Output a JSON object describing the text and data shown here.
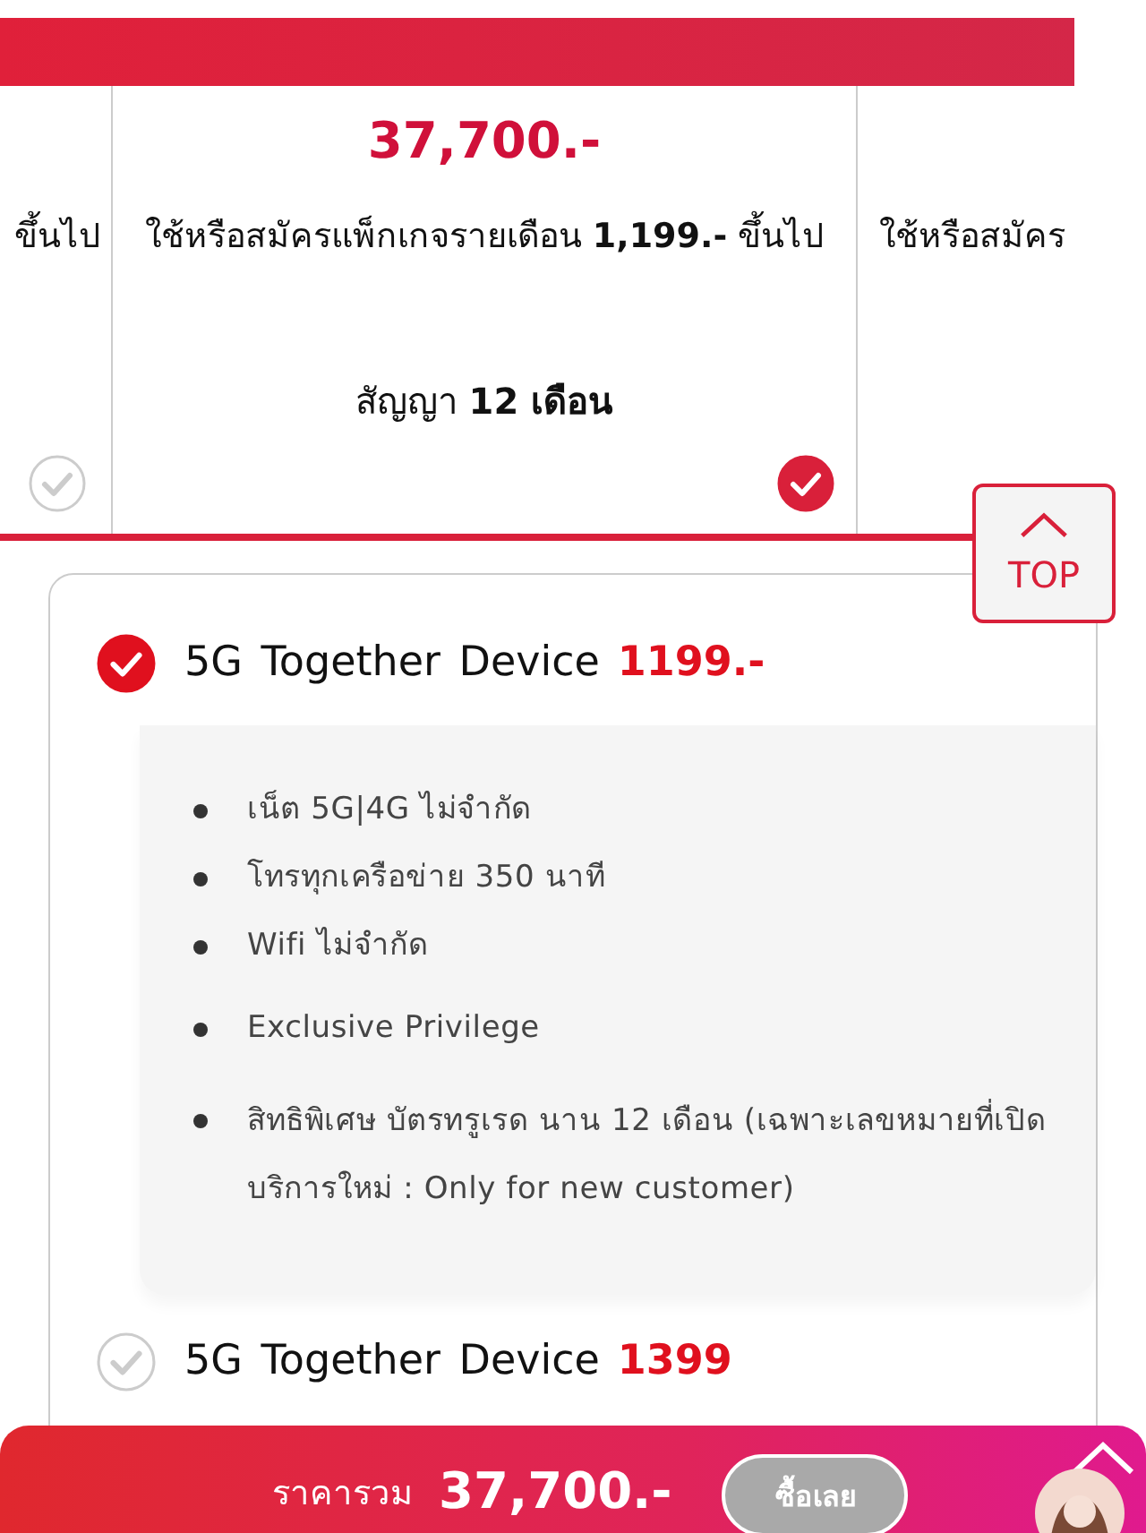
{
  "plans": [
    {
      "condition": "ขึ้นไป",
      "selected": false
    },
    {
      "price": "37,700.-",
      "condition": "ใช้หรือสมัครแพ็กเกจรายเดือน **1,199.-** ขึ้นไป",
      "contract": "สัญญา **12 เดือน**",
      "selected": true
    },
    {
      "condition": "ใช้หรือสมัคร"
    }
  ],
  "top_button": {
    "label": "TOP"
  },
  "packages": [
    {
      "name": "5G Together Device",
      "price": "1199.-",
      "selected": true,
      "feature_groups": [
        [
          "เน็ต 5G|4G ไม่จำกัด",
          "โทรทุกเครือข่าย 350 นาที",
          "Wifi ไม่จำกัด"
        ],
        [
          "Exclusive Privilege"
        ],
        [
          "สิทธิพิเศษ บัตรทรูเรด นาน 12 เดือน (เฉพาะเลขหมายที่เปิดบริการใหม่ : Only for new customer)"
        ]
      ]
    },
    {
      "name": "5G Together Device",
      "price": "1399",
      "selected": false
    }
  ],
  "bottom_bar": {
    "total_label": "ราคารวม",
    "total": "37,700.-",
    "buy_button": {
      "label": "ซื้อเลย",
      "disabled": true
    }
  }
}
